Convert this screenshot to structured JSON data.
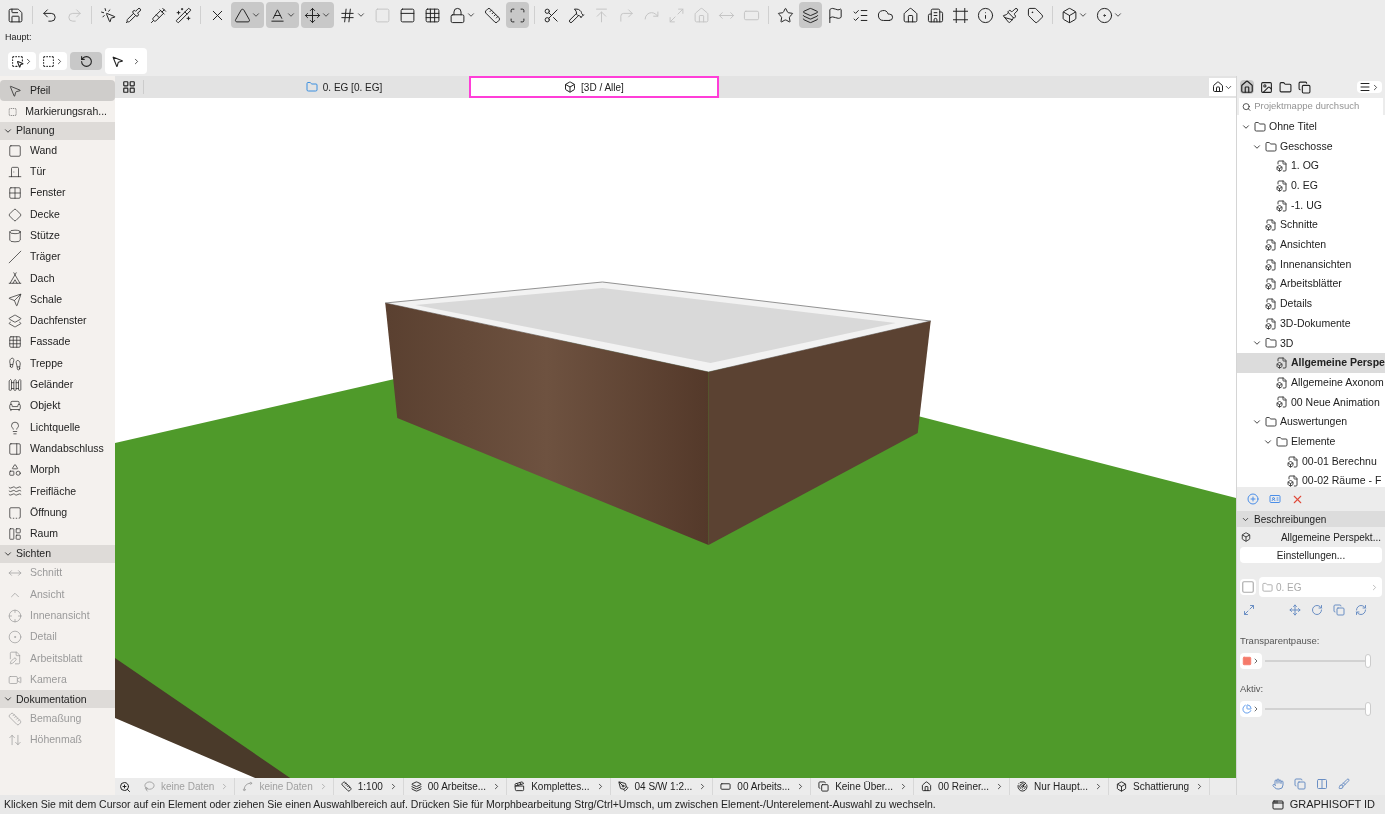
{
  "toolbar": [
    {
      "on": false,
      "dropdown": false,
      "disabled": false
    },
    {
      "on": false,
      "dropdown": false,
      "disabled": false
    },
    {
      "on": false,
      "dropdown": false,
      "disabled": true
    },
    {
      "on": false,
      "dropdown": false,
      "disabled": false
    },
    {
      "on": false,
      "dropdown": false,
      "disabled": false
    },
    {
      "on": false,
      "dropdown": false,
      "disabled": false
    },
    {
      "on": false,
      "dropdown": false,
      "disabled": false
    },
    {
      "on": false,
      "dropdown": false,
      "disabled": false
    },
    {
      "on": true,
      "dropdown": true,
      "disabled": false
    },
    {
      "on": true,
      "dropdown": true,
      "disabled": false
    },
    {
      "on": true,
      "dropdown": true,
      "disabled": false
    },
    {
      "on": false,
      "dropdown": true,
      "disabled": false
    },
    {
      "on": false,
      "dropdown": false,
      "disabled": true
    },
    {
      "on": false,
      "dropdown": false,
      "disabled": false
    },
    {
      "on": false,
      "dropdown": false,
      "disabled": false
    },
    {
      "on": false,
      "dropdown": true,
      "disabled": false
    },
    {
      "on": false,
      "dropdown": false,
      "disabled": false
    },
    {
      "on": true,
      "dropdown": false,
      "disabled": false
    },
    {
      "on": false,
      "dropdown": false,
      "disabled": false
    },
    {
      "on": false,
      "dropdown": false,
      "disabled": false
    },
    {
      "on": false,
      "dropdown": false,
      "disabled": true
    },
    {
      "on": false,
      "dropdown": false,
      "disabled": true
    },
    {
      "on": false,
      "dropdown": false,
      "disabled": true
    },
    {
      "on": false,
      "dropdown": false,
      "disabled": true
    },
    {
      "on": false,
      "dropdown": false,
      "disabled": true
    },
    {
      "on": false,
      "dropdown": false,
      "disabled": true
    },
    {
      "on": false,
      "dropdown": false,
      "disabled": true
    },
    {
      "on": false,
      "dropdown": false,
      "disabled": false
    },
    {
      "on": true,
      "dropdown": false,
      "disabled": false
    },
    {
      "on": false,
      "dropdown": false,
      "disabled": false
    },
    {
      "on": false,
      "dropdown": false,
      "disabled": false
    },
    {
      "on": false,
      "dropdown": false,
      "disabled": false
    },
    {
      "on": false,
      "dropdown": false,
      "disabled": false
    },
    {
      "on": false,
      "dropdown": false,
      "disabled": false
    },
    {
      "on": false,
      "dropdown": false,
      "disabled": false
    },
    {
      "on": false,
      "dropdown": false,
      "disabled": false
    },
    {
      "on": false,
      "dropdown": false,
      "disabled": false
    },
    {
      "on": false,
      "dropdown": false,
      "disabled": false
    },
    {
      "on": false,
      "dropdown": true,
      "disabled": false
    },
    {
      "on": false,
      "dropdown": true,
      "disabled": false
    }
  ],
  "palette_label": "Haupt:",
  "tabs": [
    {
      "label": "0. EG [0. EG]",
      "selected": false,
      "kind": "plan"
    },
    {
      "label": "[3D / Alle]",
      "selected": true,
      "kind": "perspective"
    }
  ],
  "sidebar": {
    "top": [
      {
        "label": "Pfeil",
        "selected": true
      },
      {
        "label": "Markierungsrah...",
        "selected": false
      }
    ],
    "sections": [
      {
        "title": "Planung",
        "expanded": true,
        "tools": [
          {
            "label": "Wand",
            "disabled": false
          },
          {
            "label": "Tür",
            "disabled": false
          },
          {
            "label": "Fenster",
            "disabled": false
          },
          {
            "label": "Decke",
            "disabled": false
          },
          {
            "label": "Stütze",
            "disabled": false
          },
          {
            "label": "Träger",
            "disabled": false
          },
          {
            "label": "Dach",
            "disabled": false
          },
          {
            "label": "Schale",
            "disabled": false
          },
          {
            "label": "Dachfenster",
            "disabled": false
          },
          {
            "label": "Fassade",
            "disabled": false
          },
          {
            "label": "Treppe",
            "disabled": false
          },
          {
            "label": "Geländer",
            "disabled": false
          },
          {
            "label": "Objekt",
            "disabled": false
          },
          {
            "label": "Lichtquelle",
            "disabled": false
          },
          {
            "label": "Wandabschluss",
            "disabled": false
          },
          {
            "label": "Morph",
            "disabled": false
          },
          {
            "label": "Freifläche",
            "disabled": false
          },
          {
            "label": "Öffnung",
            "disabled": false
          },
          {
            "label": "Raum",
            "disabled": false
          }
        ]
      },
      {
        "title": "Sichten",
        "expanded": true,
        "tools": [
          {
            "label": "Schnitt",
            "disabled": true
          },
          {
            "label": "Ansicht",
            "disabled": true
          },
          {
            "label": "Innenansicht",
            "disabled": true
          },
          {
            "label": "Detail",
            "disabled": true
          },
          {
            "label": "Arbeitsblatt",
            "disabled": true
          },
          {
            "label": "Kamera",
            "disabled": true
          }
        ]
      },
      {
        "title": "Dokumentation",
        "expanded": true,
        "tools": [
          {
            "label": "Bemaßung",
            "disabled": true
          },
          {
            "label": "Höhenmaß",
            "disabled": true
          }
        ]
      }
    ]
  },
  "quick_options": [
    {
      "label": "keine Daten",
      "disabled": true
    },
    {
      "label": "keine Daten",
      "disabled": true
    },
    {
      "label": "1:100",
      "disabled": false
    },
    {
      "label": "00 Arbeitse...",
      "disabled": false
    },
    {
      "label": "Komplettes...",
      "disabled": false
    },
    {
      "label": "04 S/W 1:2...",
      "disabled": false
    },
    {
      "label": "00 Arbeits...",
      "disabled": false
    },
    {
      "label": "Keine Über...",
      "disabled": false
    },
    {
      "label": "00 Reiner...",
      "disabled": false
    },
    {
      "label": "Nur Haupt...",
      "disabled": false
    },
    {
      "label": "Schattierung",
      "disabled": false
    }
  ],
  "status_message": "Klicken Sie mit dem Cursor auf ein Element oder ziehen Sie einen Auswahlbereich auf. Drücken Sie für Morphbearbeitung Strg/Ctrl+Umsch, um zwischen Element-/Unterelement-Auswahl zu wechseln.",
  "navigator": {
    "search": {
      "placeholder": "Projektmappe durchsuch"
    },
    "tree": [
      {
        "label": "Ohne Titel",
        "expanded": true,
        "selected": false,
        "children": [
          {
            "label": "Geschosse",
            "expanded": true,
            "selected": false,
            "children": [
              {
                "label": "1. OG",
                "selected": false
              },
              {
                "label": "0. EG",
                "selected": false
              },
              {
                "label": "-1. UG",
                "selected": false
              }
            ]
          },
          {
            "label": "Schnitte",
            "selected": false
          },
          {
            "label": "Ansichten",
            "selected": false
          },
          {
            "label": "Innenansichten",
            "selected": false
          },
          {
            "label": "Arbeitsblätter",
            "selected": false
          },
          {
            "label": "Details",
            "selected": false
          },
          {
            "label": "3D-Dokumente",
            "selected": false
          },
          {
            "label": "3D",
            "expanded": true,
            "selected": false,
            "children": [
              {
                "label": "Allgemeine Perspe",
                "selected": true
              },
              {
                "label": "Allgemeine Axonom",
                "selected": false
              },
              {
                "label": "00 Neue Animation",
                "selected": false
              }
            ]
          },
          {
            "label": "Auswertungen",
            "expanded": true,
            "selected": false,
            "children": [
              {
                "label": "Elemente",
                "expanded": true,
                "selected": false,
                "children": [
                  {
                    "label": "00-01 Berechnu",
                    "selected": false
                  },
                  {
                    "label": "00-02 Räume - F",
                    "selected": false
                  }
                ]
              }
            ]
          }
        ]
      }
    ],
    "section_title": "Beschreibungen",
    "section_expanded": true,
    "view_name": "Allgemeine Perspekt...",
    "settings_button": "Einstellungen...",
    "story_field": "0. EG",
    "sliders": [
      {
        "label": "Transparentpause:",
        "level": 1.0
      },
      {
        "label": "Aktiv:",
        "level": 1.0
      }
    ],
    "brand": "GRAPHISOFT ID"
  }
}
